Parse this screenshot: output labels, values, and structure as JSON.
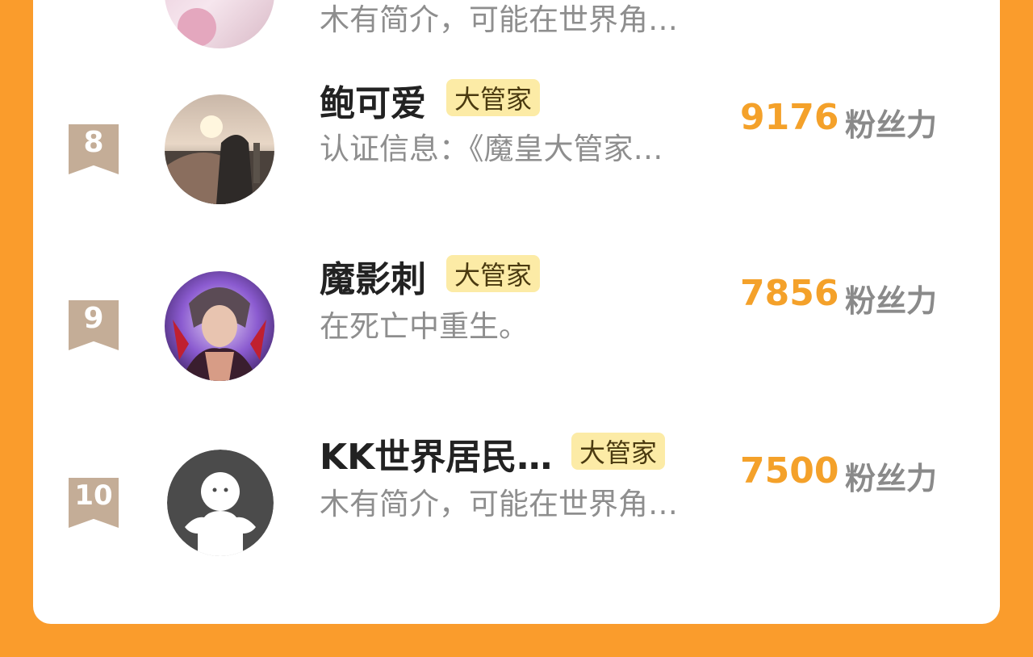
{
  "badge_label": "大管家",
  "unit_label": "粉丝力",
  "colors": {
    "background": "#FA9C2C",
    "card": "#FFFFFF",
    "score": "#F4A12A",
    "badge_bg": "#FCEBA6",
    "rank_bg": "#C4AD97"
  },
  "partial_row": {
    "desc": "木有简介，可能在世界角…"
  },
  "rows": [
    {
      "rank": "8",
      "name": "鲍可爱",
      "desc": "认证信息：《魔皇大管家…",
      "score": "9176",
      "avatar_icon": "sunset-photo-avatar"
    },
    {
      "rank": "9",
      "name": "魔影刺",
      "desc": "在死亡中重生。",
      "score": "7856",
      "avatar_icon": "anime-character-avatar"
    },
    {
      "rank": "10",
      "name": "KK世界居民…",
      "desc": "木有简介，可能在世界角…",
      "score": "7500",
      "avatar_icon": "default-user-avatar"
    }
  ]
}
